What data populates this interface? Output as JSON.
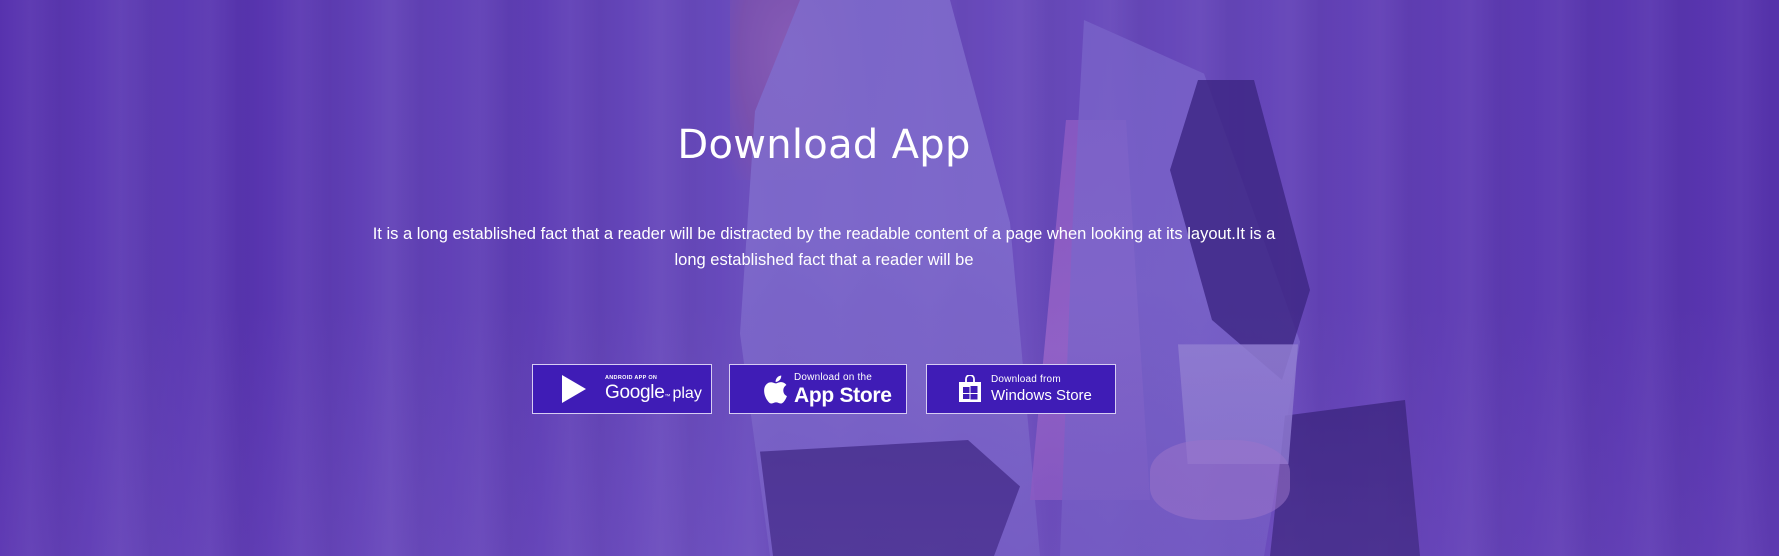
{
  "hero": {
    "title": "Download App",
    "description": "It is a long established fact that a reader will be distracted by the readable content of a page when looking at its layout.It is a long established fact that a reader will be"
  },
  "store_buttons": {
    "google": {
      "top_line": "ANDROID APP ON",
      "brand": "Google",
      "tm": "™",
      "suffix": "play",
      "icon": "play-triangle-icon"
    },
    "apple": {
      "top_line": "Download on the",
      "main_line": "App Store",
      "icon": "apple-icon"
    },
    "windows": {
      "top_line": "Download from",
      "main_line": "Windows Store",
      "icon": "windows-store-bag-icon"
    }
  },
  "colors": {
    "overlay": "#6a4bb8",
    "button_bg": "#3f1cb6",
    "button_border": "#d7cdf3",
    "text": "#ffffff"
  }
}
